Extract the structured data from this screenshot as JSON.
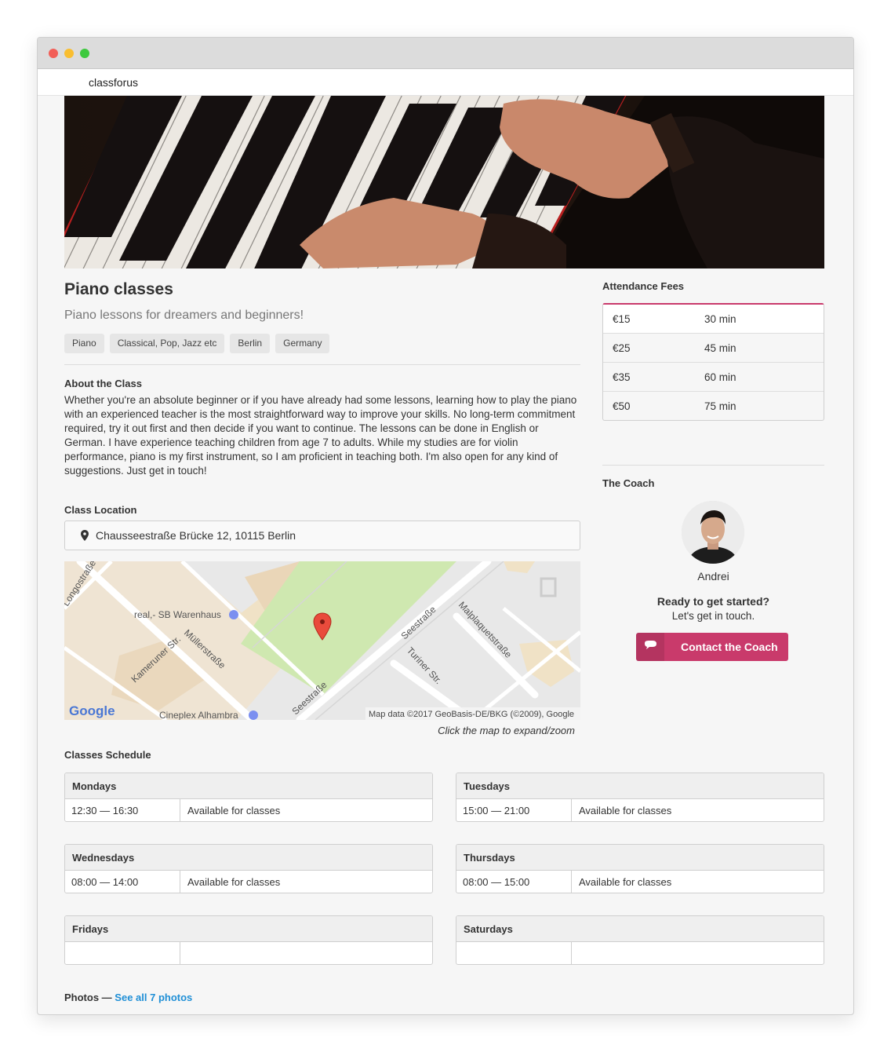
{
  "app": {
    "brand": "classforus"
  },
  "class": {
    "title": "Piano classes",
    "subtitle": "Piano lessons for dreamers and beginners!",
    "tags": [
      "Piano",
      "Classical, Pop, Jazz etc",
      "Berlin",
      "Germany"
    ],
    "about_title": "About the Class",
    "about_text": "Whether you're an absolute beginner or if you have already had some lessons, learning how to play the piano with an experienced teacher is the most straightforward way to improve your skills. No long-term commitment required, try it out first and then decide if you want to continue. The lessons can be done in English or German. I have experience teaching children from age 7 to adults. While my studies are for violin performance, piano is my first instrument, so I am proficient in teaching both. I'm also open for any kind of suggestions. Just get in touch!"
  },
  "location": {
    "title": "Class Location",
    "address": "Chausseestraße Brücke 12, 10115 Berlin",
    "map": {
      "labels": [
        "real,- SB Warenhaus",
        "Cineplex Alhambra",
        "Müllerstraße",
        "Kameruner Str.",
        "Seestraße",
        "Turiner Str.",
        "Malplaquetstraße",
        "Longostraße"
      ],
      "logo": "Google",
      "attribution": "Map data ©2017 GeoBasis-DE/BKG (©2009), Google"
    },
    "map_caption": "Click the map to expand/zoom"
  },
  "fees": {
    "title": "Attendance Fees",
    "rows": [
      {
        "price": "€15",
        "duration": "30 min"
      },
      {
        "price": "€25",
        "duration": "45 min"
      },
      {
        "price": "€35",
        "duration": "60 min"
      },
      {
        "price": "€50",
        "duration": "75 min"
      }
    ]
  },
  "coach": {
    "title": "The Coach",
    "name": "Andrei",
    "cta_question": "Ready to get started?",
    "cta_sub": "Let's get in touch.",
    "contact_label": "Contact the Coach"
  },
  "schedule": {
    "title": "Classes Schedule",
    "days": [
      {
        "day": "Mondays",
        "time": "12:30 — 16:30",
        "status": "Available for classes"
      },
      {
        "day": "Tuesdays",
        "time": "15:00 — 21:00",
        "status": "Available for classes"
      },
      {
        "day": "Wednesdays",
        "time": "08:00 — 14:00",
        "status": "Available for classes"
      },
      {
        "day": "Thursdays",
        "time": "08:00 — 15:00",
        "status": "Available for classes"
      },
      {
        "day": "Fridays",
        "time": "",
        "status": ""
      },
      {
        "day": "Saturdays",
        "time": "",
        "status": ""
      }
    ]
  },
  "photos": {
    "label": "Photos —",
    "link": "See all 7 photos"
  },
  "colors": {
    "accent": "#c93a6b",
    "link": "#1f8fd6",
    "map_park": "#cfe8b0"
  },
  "icons": [
    "map-pin-icon",
    "chat-bubble-icon"
  ]
}
